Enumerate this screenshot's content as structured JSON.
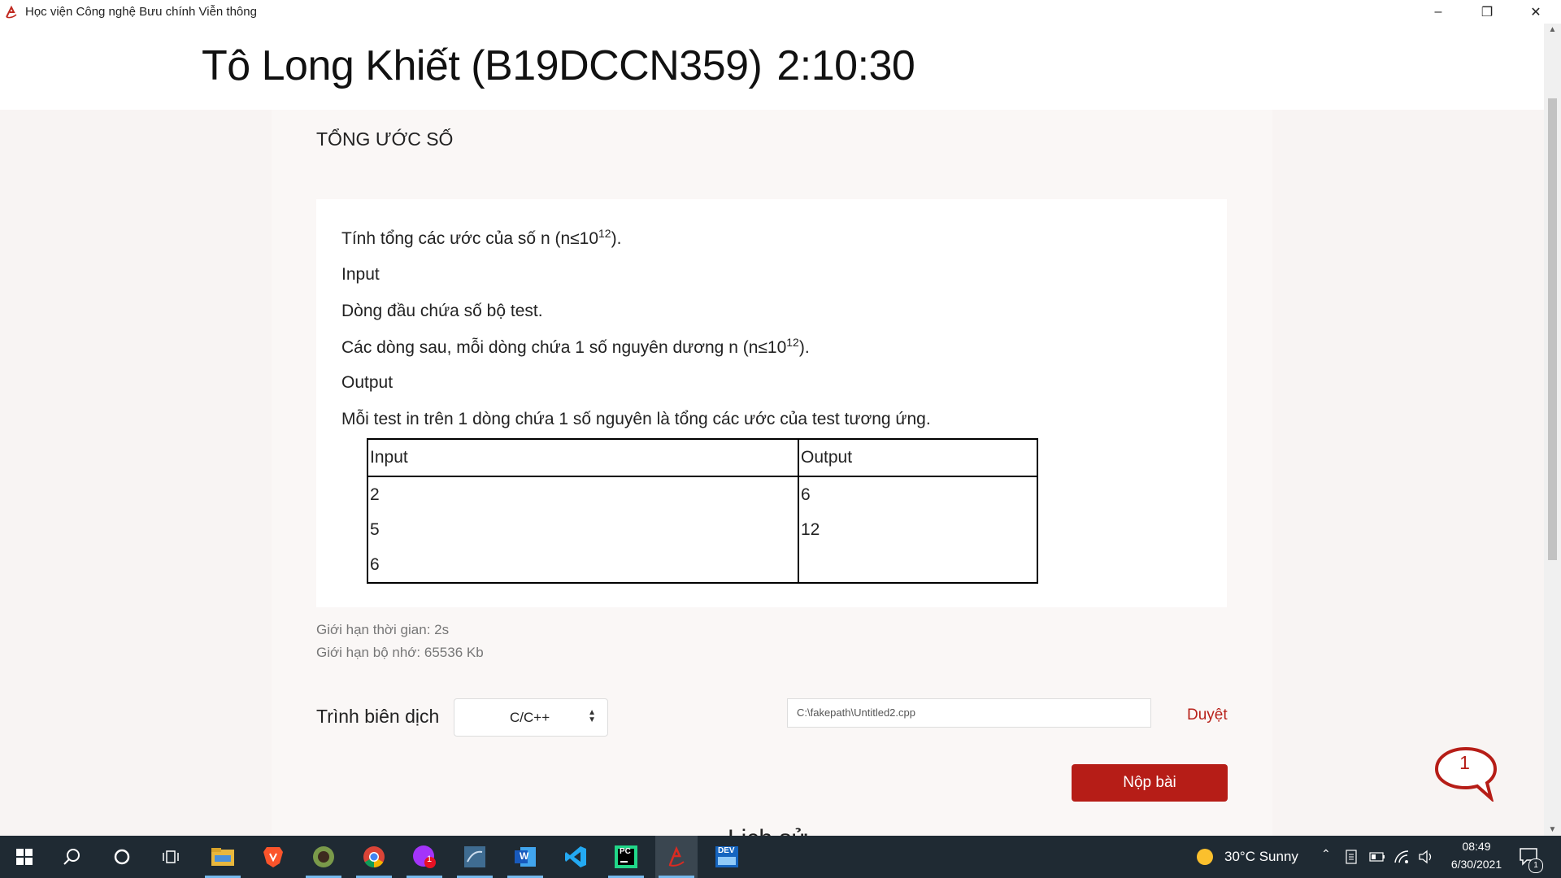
{
  "window": {
    "title": "Học viện Công nghệ Bưu chính Viễn thông",
    "minimize_icon": "–",
    "restore_icon": "❐",
    "close_icon": "✕"
  },
  "header": {
    "student": "Tô Long Khiết (B19DCCN359)",
    "timer": "2:10:30"
  },
  "problem": {
    "title": "TỔNG ƯỚC SỐ",
    "statement_pre": "Tính tổng các ước của số n (n≤10",
    "statement_exp": "12",
    "statement_post": ").",
    "input_heading": "Input",
    "input_line1": "Dòng đầu chứa số bộ test.",
    "input_line2_pre": "Các dòng sau, mỗi dòng chứa 1 số nguyên dương n (n≤10",
    "input_line2_exp": "12",
    "input_line2_post": ").",
    "output_heading": "Output",
    "output_line": "Mỗi test in trên 1 dòng chứa 1 số nguyên là tổng các ước của test tương ứng.",
    "example": {
      "headers": [
        "Input",
        "Output"
      ],
      "input_lines": [
        "2",
        "5",
        "6"
      ],
      "output_lines": [
        "6",
        "12"
      ]
    },
    "time_limit": "Giới hạn thời gian: 2s",
    "memory_limit": "Giới hạn bộ nhớ: 65536 Kb"
  },
  "submission": {
    "compiler_label": "Trình biên dịch",
    "compiler_value": "C/C++",
    "file_path": "C:\\fakepath\\Untitled2.cpp",
    "browse_label": "Duyệt",
    "submit_label": "Nộp bài",
    "history_heading": "Lịch sử"
  },
  "chat": {
    "badge_count": "1"
  },
  "taskbar": {
    "weather": "30°C  Sunny",
    "time": "08:49",
    "date": "6/30/2021",
    "notification_count": "1",
    "app_badge": "1",
    "pycharm_label": "PC",
    "devcpp_label": "DEV",
    "word_label": "W",
    "icons": [
      "windows-start-icon",
      "search-icon",
      "cortana-icon",
      "task-view-icon",
      "file-explorer-icon",
      "brave-icon",
      "app-icon",
      "chrome-icon",
      "messenger-icon",
      "mysql-workbench-icon",
      "word-icon",
      "vscode-icon",
      "pycharm-icon",
      "exam-app-icon",
      "devcpp-icon"
    ]
  },
  "colors": {
    "accent": "#b61d17",
    "taskbar": "#1f2a33",
    "content_bg": "#faf7f6",
    "page_bg": "#f8f4f3"
  }
}
